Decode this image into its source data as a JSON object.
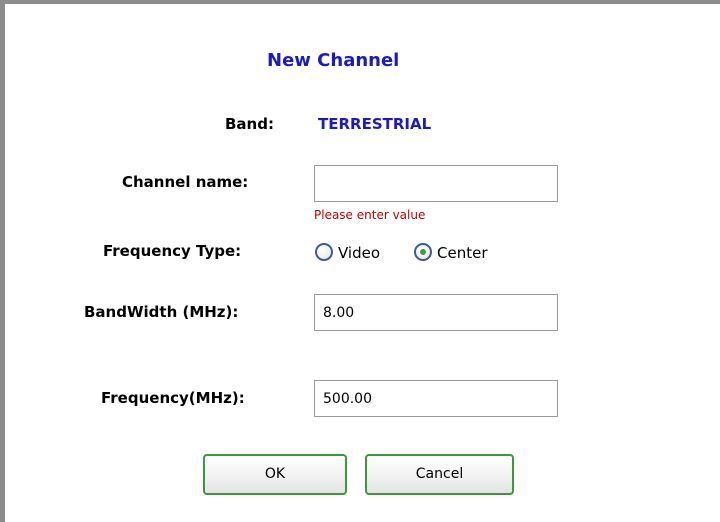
{
  "dialog": {
    "title": "New Channel",
    "band_label": "Band:",
    "band_value": "TERRESTRIAL",
    "channel_name_label": "Channel name:",
    "channel_name_value": "",
    "channel_name_error": "Please enter value",
    "frequency_type_label": "Frequency Type:",
    "frequency_type_options": [
      "Video",
      "Center"
    ],
    "frequency_type_selected": "Center",
    "bandwidth_label": "BandWidth (MHz):",
    "bandwidth_value": "8.00",
    "frequency_label": "Frequency(MHz):",
    "frequency_value": "500.00",
    "ok_label": "OK",
    "cancel_label": "Cancel"
  },
  "colors": {
    "accent_blue": "#1a1acc",
    "error_red": "#c00000",
    "button_border_green": "#3a9a3a",
    "radio_dot_green": "#2fa82f"
  }
}
